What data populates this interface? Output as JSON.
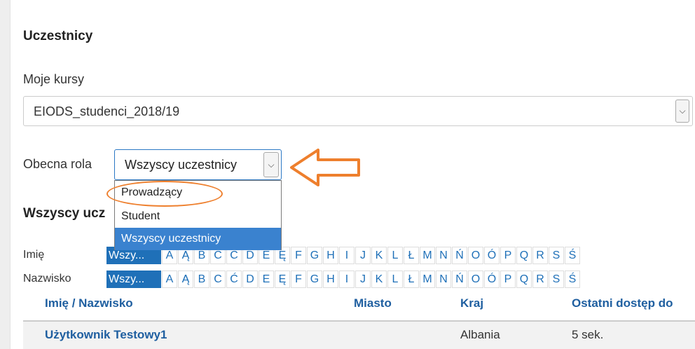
{
  "page": {
    "title": "Uczestnicy"
  },
  "course": {
    "label": "Moje kursy",
    "selected": "EIODS_studenci_2018/19"
  },
  "role": {
    "label": "Obecna rola",
    "selected": "Wszyscy uczestnicy",
    "options": [
      "Prowadzący",
      "Student",
      "Wszyscy uczestnicy"
    ]
  },
  "section": {
    "heading": "Wszyscy ucz"
  },
  "filters": {
    "first_name_label": "Imię",
    "last_name_label": "Nazwisko",
    "first_name_letters": [
      "Wszy...",
      "A",
      "Ą",
      "B",
      "C",
      "Ć",
      "D",
      "E",
      "Ę",
      "F",
      "G",
      "H",
      "I",
      "J",
      "K",
      "L",
      "Ł",
      "M",
      "N",
      "Ń",
      "O",
      "Ó",
      "P",
      "Q",
      "R",
      "S",
      "Ś"
    ],
    "last_name_letters": [
      "Wszy...",
      "A",
      "Ą",
      "B",
      "C",
      "Ć",
      "D",
      "E",
      "Ę",
      "F",
      "G",
      "H",
      "I",
      "J",
      "K",
      "L",
      "Ł",
      "M",
      "N",
      "Ń",
      "O",
      "Ó",
      "P",
      "Q",
      "R",
      "S",
      "Ś"
    ]
  },
  "table": {
    "headers": {
      "name": "Imię / Nazwisko",
      "city": "Miasto",
      "country": "Kraj",
      "last_access": "Ostatni dostęp do"
    },
    "rows": [
      {
        "name": "Użytkownik Testowy1",
        "city": "",
        "country": "Albania",
        "last_access": "5 sek."
      }
    ]
  },
  "colors": {
    "link": "#1f70b8",
    "selected_option": "#3a82cf",
    "annotation": "#ee7f2d"
  }
}
